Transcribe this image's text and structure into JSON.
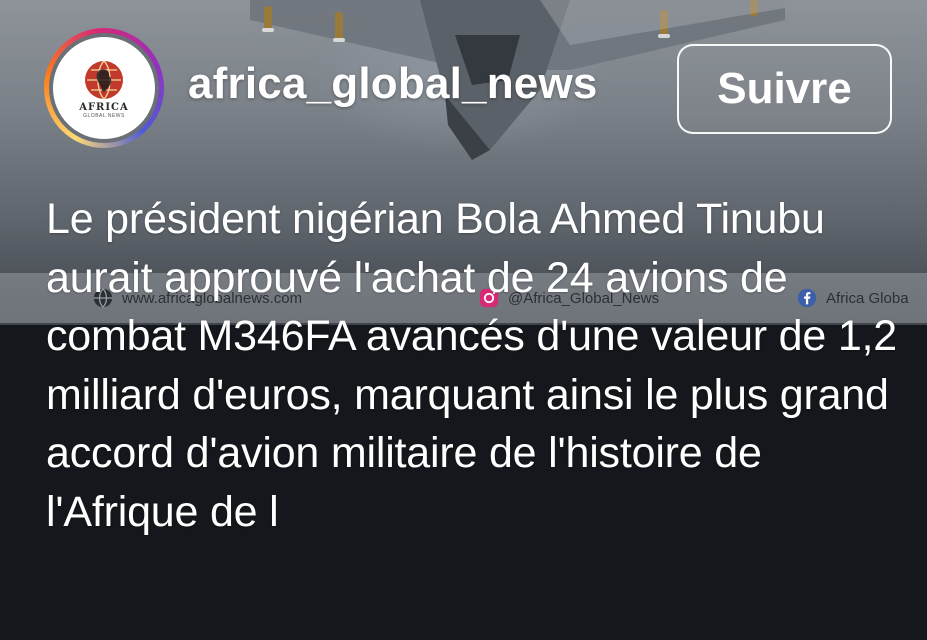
{
  "header": {
    "username": "africa_global_news",
    "follow_label": "Suivre"
  },
  "avatar": {
    "brand": "AFRICA",
    "sub": "GLOBAL NEWS",
    "ring_colors": [
      "#feda75",
      "#fa7e1e",
      "#d62976",
      "#962fbf",
      "#4f5bd5"
    ]
  },
  "watermark": {
    "website": "www.africaglobalnews.com",
    "instagram": "@Africa_Global_News",
    "facebook": "Africa Globa",
    "icons": [
      "globe-icon",
      "instagram-icon",
      "facebook-icon"
    ]
  },
  "caption": {
    "text": "Le président nigérian Bola Ahmed Tinubu aurait approuvé l'achat de 24 avions de combat M346FA avancés d'une valeur de 1,2 milliard d'euros, marquant ainsi le plus grand accord d'avion militaire de l'histoire de l'Afrique de l"
  },
  "colors": {
    "background": "#14171c",
    "text": "#ffffff"
  }
}
